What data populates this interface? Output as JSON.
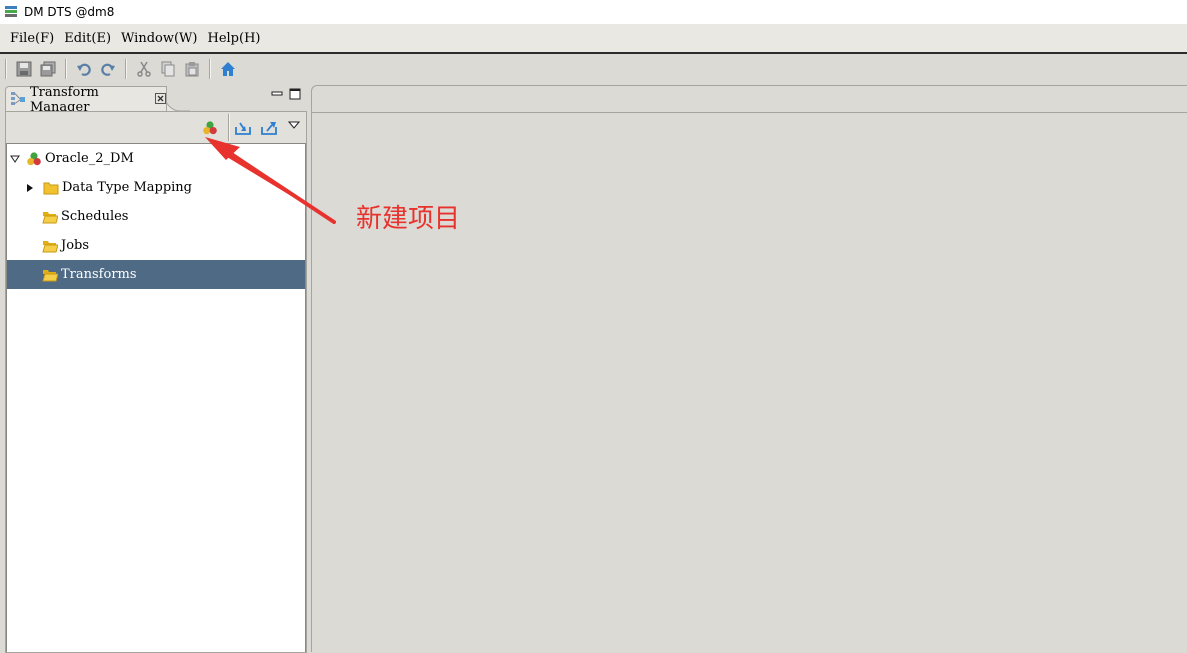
{
  "window": {
    "title": "DM DTS @dm8"
  },
  "menu": [
    {
      "label": "File(F)",
      "accel": "F"
    },
    {
      "label": "Edit(E)",
      "accel": "E"
    },
    {
      "label": "Window(W)",
      "accel": "W"
    },
    {
      "label": "Help(H)",
      "accel": "H"
    }
  ],
  "menu_labels": {
    "file": "File(F)",
    "edit": "Edit(E)",
    "window": "Window(W)",
    "help": "Help(H)"
  },
  "toolbar": {
    "icons": [
      "save-icon",
      "save-all-icon",
      "undo-icon",
      "redo-icon",
      "cut-icon",
      "copy-icon",
      "paste-icon",
      "home-icon"
    ]
  },
  "view": {
    "tab_label": "Transform Manager",
    "toolbar_icons": [
      "new-project-icon",
      "import-icon",
      "export-icon",
      "view-menu-icon"
    ]
  },
  "tree": {
    "root": "Oracle_2_DM",
    "children": [
      {
        "label": "Data Type Mapping",
        "expandable": true,
        "selected": false
      },
      {
        "label": "Schedules",
        "expandable": false,
        "selected": false
      },
      {
        "label": "Jobs",
        "expandable": false,
        "selected": false
      },
      {
        "label": "Transforms",
        "expandable": false,
        "selected": true
      }
    ]
  },
  "annotation": {
    "text": "新建项目"
  },
  "colors": {
    "selection": "#4e6a85",
    "annotation": "#e8322d",
    "folder": "#f2c12e",
    "background": "#dcdad5"
  }
}
